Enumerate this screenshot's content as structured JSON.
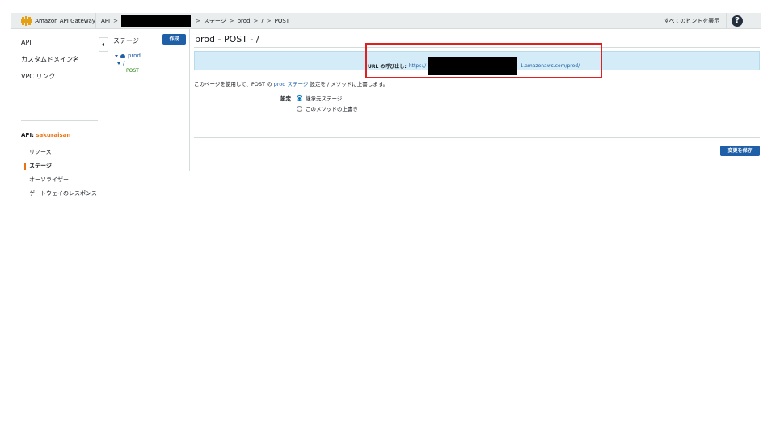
{
  "topbar": {
    "brand": "Amazon API Gateway",
    "crumbs": {
      "api": "API",
      "sep": ">",
      "stage": "ステージ",
      "prod": "prod",
      "slash": "/",
      "post": "POST"
    },
    "hints": "すべてのヒントを表示",
    "help": "?"
  },
  "nav": {
    "api": "API",
    "custom_domain": "カスタムドメイン名",
    "vpc_link": "VPC リンク",
    "api_label": "API: ",
    "api_name": "sakuraisan",
    "resources": "リソース",
    "stages": "ステージ",
    "authorizers": "オーソライザー",
    "gateway_responses": "ゲートウェイのレスポンス"
  },
  "stages_panel": {
    "title": "ステージ",
    "create": "作成",
    "tree": {
      "prod": "prod",
      "root": "/",
      "post": "POST"
    }
  },
  "main": {
    "title": "prod - POST - /",
    "url": {
      "label": "URL の呼び出し:",
      "prefix": "https://",
      "suffix": "-1.amazonaws.com/prod/"
    },
    "desc": {
      "before": "このページを使用して、POST の",
      "link_prod": "prod",
      "link_stage": "ステージ",
      "after": "設定を / メソッドに上書します。"
    },
    "setting_label": "設定",
    "radio_inherit": "継承元ステージ",
    "radio_override": "このメソッドの上書き",
    "save": "変更を保存"
  },
  "colors": {
    "accent": "#1e5fa8",
    "brand_orange": "#ec7211",
    "highlight": "#e02020",
    "url_bg": "#d4ecf7"
  }
}
